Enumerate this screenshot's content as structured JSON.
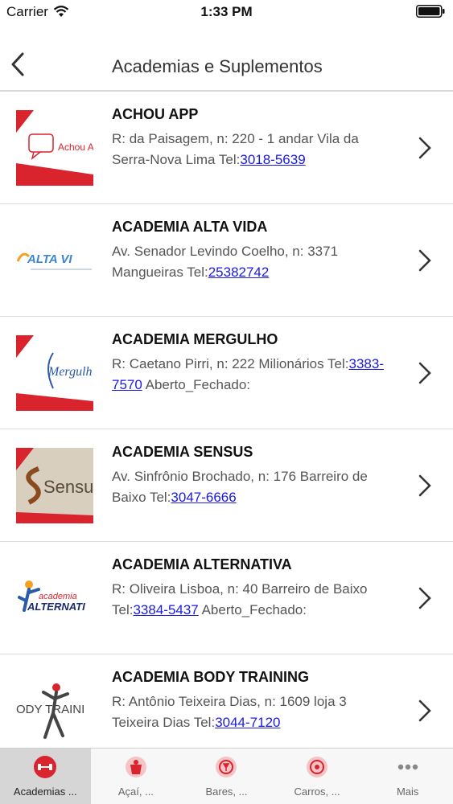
{
  "status": {
    "carrier": "Carrier",
    "time": "1:33 PM"
  },
  "nav": {
    "title": "Academias e Suplementos"
  },
  "items": [
    {
      "name": "ACHOU APP",
      "address": "R: da Paisagem, n: 220 - 1 andar Vila da Serra-Nova Lima Tel:",
      "phone": "3018-5639",
      "suffix": "",
      "thumb_text": "Achou A"
    },
    {
      "name": "ACADEMIA ALTA VIDA",
      "address": "Av. Senador Levindo Coelho, n: 3371 Mangueiras Tel:",
      "phone": "25382742",
      "suffix": "",
      "thumb_text": "ALTA VI"
    },
    {
      "name": "ACADEMIA MERGULHO",
      "address": "R: Caetano Pirri, n: 222 Milionários Tel:",
      "phone": "3383-7570",
      "suffix": " Aberto_Fechado:",
      "thumb_text": "Mergulh"
    },
    {
      "name": "ACADEMIA SENSUS",
      "address": "Av. Sinfrônio Brochado, n: 176 Barreiro de Baixo Tel:",
      "phone": "3047-6666",
      "suffix": "",
      "thumb_text": "Sensu"
    },
    {
      "name": "ACADEMIA ALTERNATIVA",
      "address": "R: Oliveira Lisboa, n: 40 Barreiro de Baixo Tel:",
      "phone": "3384-5437",
      "suffix": " Aberto_Fechado:",
      "thumb_text": "ALTERNATI"
    },
    {
      "name": "ACADEMIA BODY TRAINING",
      "address": "R: Antônio Teixeira Dias, n: 1609 loja 3 Teixeira Dias Tel:",
      "phone": "3044-7120",
      "suffix": "",
      "thumb_text": "ODY TRAINI"
    }
  ],
  "tabs": [
    {
      "label": "Academias ...",
      "icon": "dumbbell-icon",
      "active": true
    },
    {
      "label": "Açaí, ...",
      "icon": "acai-icon",
      "active": false
    },
    {
      "label": "Bares, ...",
      "icon": "bar-icon",
      "active": false
    },
    {
      "label": "Carros, ...",
      "icon": "car-icon",
      "active": false
    },
    {
      "label": "Mais",
      "icon": "more-icon",
      "active": false
    }
  ],
  "colors": {
    "accent_red": "#d9232d",
    "link_blue": "#1a1ae0"
  }
}
